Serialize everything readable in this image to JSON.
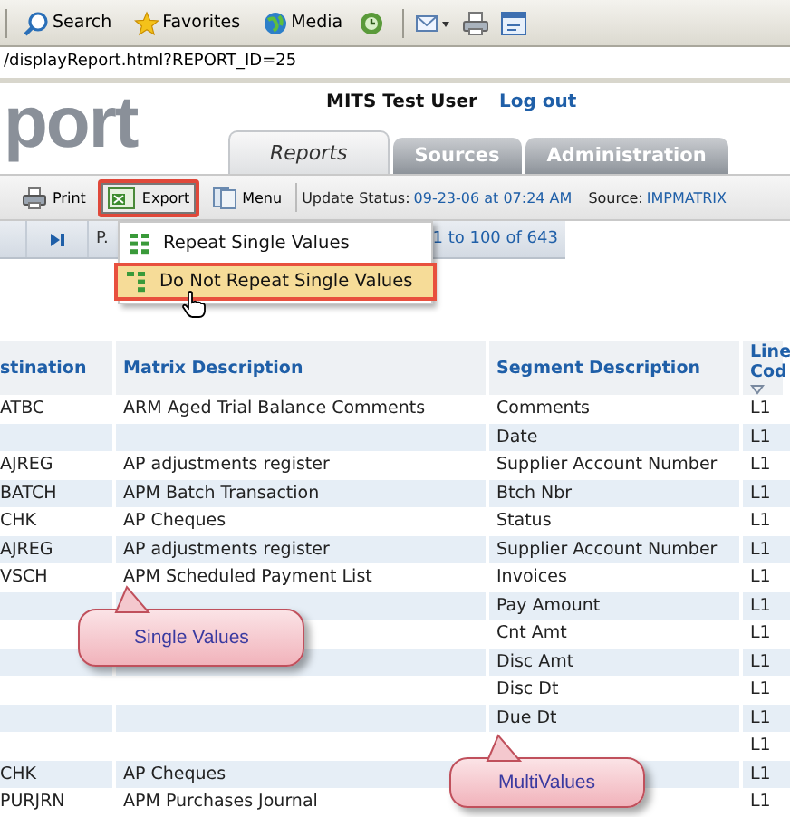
{
  "browser_toolbar": {
    "buttons": [
      {
        "label": "Search",
        "kind": "search"
      },
      {
        "label": "Favorites",
        "kind": "favorites"
      },
      {
        "label": "Media",
        "kind": "media"
      }
    ]
  },
  "address_bar": {
    "value": "/displayReport.html?REPORT_ID=25"
  },
  "header": {
    "logo_text": "port",
    "user": "MITS Test User",
    "logout": "Log out"
  },
  "tabs": [
    {
      "label": "Reports",
      "selected": true
    },
    {
      "label": "Sources",
      "selected": false
    },
    {
      "label": "Administration",
      "selected": false
    }
  ],
  "toolbar": {
    "print": "Print",
    "export": "Export",
    "menu": "Menu",
    "update_label": "Update Status:",
    "update_value": "09-23-06 at 07:24 AM",
    "source_label": "Source:",
    "source_value": "IMPMATRIX"
  },
  "pager": {
    "page_label": "P.",
    "range": "1 to 100 of 643"
  },
  "export_menu": {
    "items": [
      {
        "label": "Repeat Single Values",
        "selected": false
      },
      {
        "label": "Do Not Repeat Single Values",
        "selected": true
      }
    ]
  },
  "table": {
    "columns": [
      "stination",
      "Matrix Description",
      "Segment Description",
      "Line Cod"
    ],
    "rows": [
      [
        "ATBC",
        "ARM Aged Trial Balance Comments",
        "Comments",
        "L1"
      ],
      [
        "",
        "",
        "Date",
        "L1"
      ],
      [
        "AJREG",
        "AP adjustments register",
        "Supplier Account Number",
        "L1"
      ],
      [
        "BATCH",
        "APM Batch Transaction",
        "Btch Nbr",
        "L1"
      ],
      [
        "CHK",
        "AP Cheques",
        "Status",
        "L1"
      ],
      [
        "AJREG",
        "AP adjustments register",
        "Supplier Account Number",
        "L1"
      ],
      [
        "VSCH",
        "APM Scheduled Payment List",
        "Invoices",
        "L1"
      ],
      [
        "",
        "",
        "Pay Amount",
        "L1"
      ],
      [
        "",
        "",
        "Cnt Amt",
        "L1"
      ],
      [
        "",
        "",
        "Disc Amt",
        "L1"
      ],
      [
        "",
        "",
        "Disc Dt",
        "L1"
      ],
      [
        "",
        "",
        "Due Dt",
        "L1"
      ],
      [
        "",
        "",
        "",
        "L1"
      ],
      [
        "CHK",
        "AP Cheques",
        "",
        "L1"
      ],
      [
        "PURJRN",
        "APM Purchases Journal",
        "",
        "L1"
      ]
    ]
  },
  "callouts": [
    {
      "text": "Single Values"
    },
    {
      "text": "MultiValues"
    }
  ]
}
